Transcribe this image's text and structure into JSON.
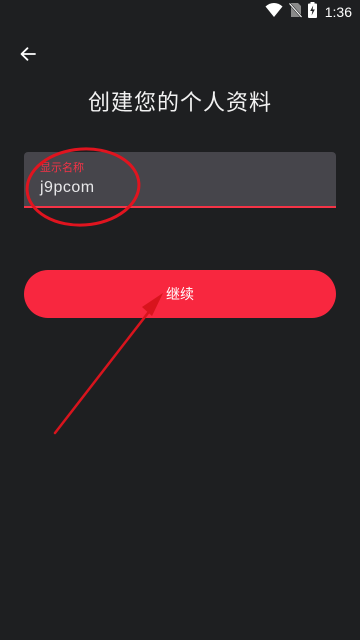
{
  "status_bar": {
    "time": "1:36",
    "icons": [
      "wifi-icon",
      "no-sim-icon",
      "battery-charging-icon"
    ]
  },
  "app_bar": {
    "back_icon": "arrow-back-icon"
  },
  "page": {
    "title": "创建您的个人资料"
  },
  "form": {
    "display_name": {
      "label": "显示名称",
      "value": "j9pcom"
    },
    "continue_label": "继续"
  },
  "colors": {
    "background": "#1e1f21",
    "accent": "#f8273f",
    "field_background": "#46454b",
    "annotation": "#e0141f"
  }
}
